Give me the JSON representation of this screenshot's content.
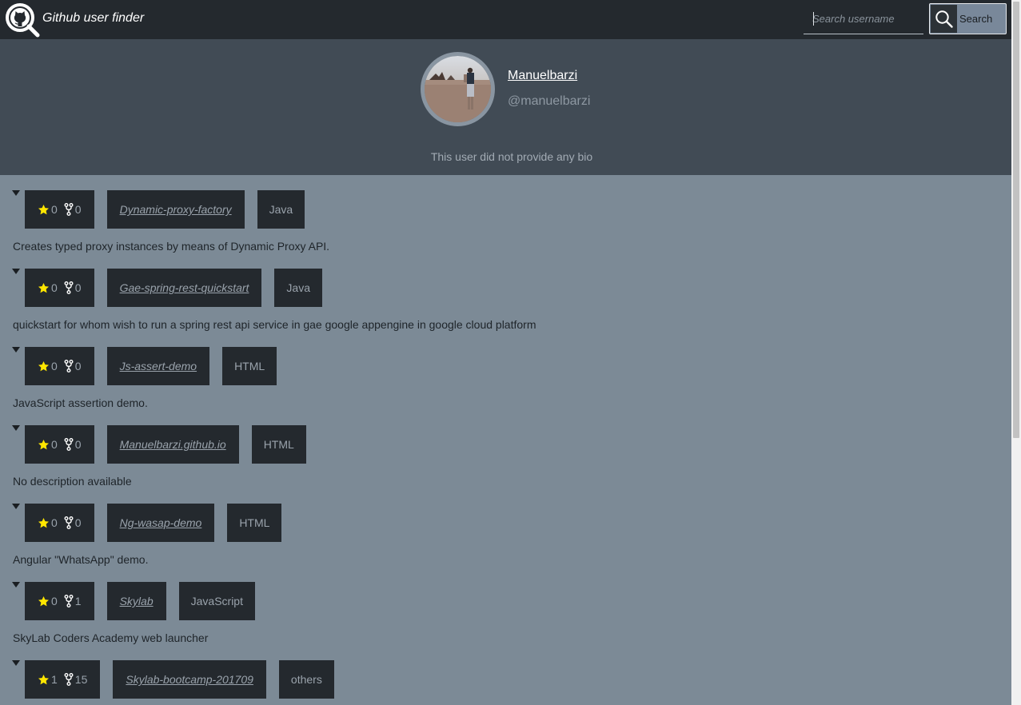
{
  "header": {
    "title": "Github user finder",
    "logo_icon": "github-search-logo-icon",
    "search": {
      "placeholder": "Search username",
      "value": ""
    },
    "search_button_label": "Search",
    "search_button_icon": "search-icon"
  },
  "profile": {
    "name": "Manuelbarzi",
    "login": "@manuelbarzi",
    "bio": "This user did not provide any bio"
  },
  "repos": [
    {
      "stars": "0",
      "forks": "0",
      "name": "Dynamic-proxy-factory",
      "language": "Java",
      "description": "Creates typed proxy instances by means of Dynamic Proxy API."
    },
    {
      "stars": "0",
      "forks": "0",
      "name": "Gae-spring-rest-quickstart",
      "language": "Java",
      "description": "quickstart for whom wish to run a spring rest api service in gae google appengine in google cloud platform"
    },
    {
      "stars": "0",
      "forks": "0",
      "name": "Js-assert-demo",
      "language": "HTML",
      "description": "JavaScript assertion demo."
    },
    {
      "stars": "0",
      "forks": "0",
      "name": "Manuelbarzi.github.io",
      "language": "HTML",
      "description": "No description available"
    },
    {
      "stars": "0",
      "forks": "0",
      "name": "Ng-wasap-demo",
      "language": "HTML",
      "description": "Angular \"WhatsApp\" demo."
    },
    {
      "stars": "0",
      "forks": "1",
      "name": "Skylab",
      "language": "JavaScript",
      "description": "SkyLab Coders Academy web launcher"
    },
    {
      "stars": "1",
      "forks": "15",
      "name": "Skylab-bootcamp-201709",
      "language": "others",
      "description": ""
    }
  ],
  "colors": {
    "header_bg": "#24292e",
    "profile_bg": "#414b55",
    "page_bg": "#7c8a96",
    "chip_bg": "#24292e",
    "star": "#ffe600"
  }
}
